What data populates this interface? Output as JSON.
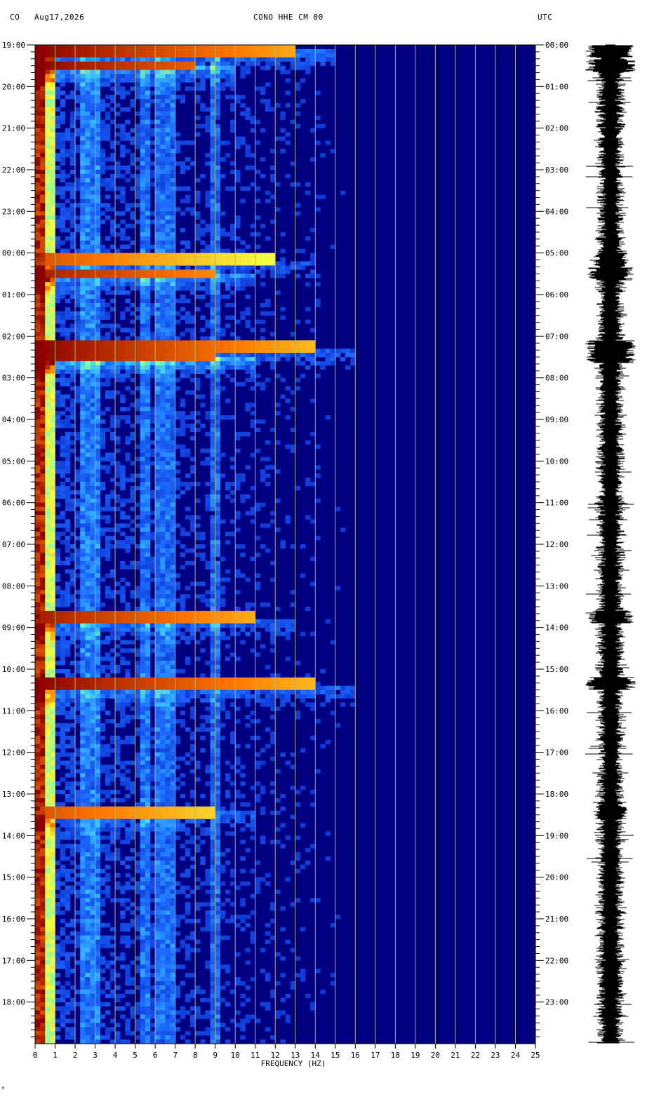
{
  "header": {
    "network": "CO",
    "date": "Aug17,2026",
    "channel": "CONO HHE CM 00",
    "utc_label": "UTC"
  },
  "footer_mark": "*",
  "colors": {
    "background": "#000080",
    "low": "#0a1fb4",
    "mid": "#3fb7ff",
    "high_yellow": "#f5ff40",
    "saturated": "#8b0000",
    "grid": "#b6b26a",
    "trace": "#000000"
  },
  "chart_data": {
    "type": "heatmap",
    "title": "CONO HHE CM 00",
    "xlabel": "FREQUENCY (HZ)",
    "xlim": [
      0,
      25
    ],
    "x_ticks": [
      "0",
      "1",
      "2",
      "3",
      "4",
      "5",
      "6",
      "7",
      "8",
      "9",
      "10",
      "11",
      "12",
      "13",
      "14",
      "15",
      "16",
      "17",
      "18",
      "19",
      "20",
      "21",
      "22",
      "23",
      "24",
      "25"
    ],
    "left_time_labels": [
      "19:00",
      "20:00",
      "21:00",
      "22:00",
      "23:00",
      "00:00",
      "01:00",
      "02:00",
      "03:00",
      "04:00",
      "05:00",
      "06:00",
      "07:00",
      "08:00",
      "09:00",
      "10:00",
      "11:00",
      "12:00",
      "13:00",
      "14:00",
      "15:00",
      "16:00",
      "17:00",
      "18:00"
    ],
    "right_time_labels": [
      "00:00",
      "01:00",
      "02:00",
      "03:00",
      "04:00",
      "05:00",
      "06:00",
      "07:00",
      "08:00",
      "09:00",
      "10:00",
      "11:00",
      "12:00",
      "13:00",
      "14:00",
      "15:00",
      "16:00",
      "17:00",
      "18:00",
      "19:00",
      "20:00",
      "21:00",
      "22:00",
      "23:00"
    ],
    "time_span_hours": 24,
    "grid_lines": "vertical, every 1 Hz",
    "energy_bursts": [
      {
        "hour_offset": 0.15,
        "fmax_hz": 13,
        "strength": 1.0
      },
      {
        "hour_offset": 0.5,
        "fmax_hz": 8,
        "strength": 1.0
      },
      {
        "hour_offset": 5.15,
        "fmax_hz": 12,
        "strength": 0.7
      },
      {
        "hour_offset": 5.5,
        "fmax_hz": 9,
        "strength": 0.9
      },
      {
        "hour_offset": 7.25,
        "fmax_hz": 14,
        "strength": 1.0
      },
      {
        "hour_offset": 7.5,
        "fmax_hz": 9,
        "strength": 1.0
      },
      {
        "hour_offset": 13.75,
        "fmax_hz": 11,
        "strength": 0.9
      },
      {
        "hour_offset": 15.35,
        "fmax_hz": 14,
        "strength": 1.0
      },
      {
        "hour_offset": 18.45,
        "fmax_hz": 9,
        "strength": 0.7
      }
    ],
    "persistent_bands_hz": [
      2.5,
      3.0,
      5.5,
      6.2,
      6.8,
      9.0
    ]
  }
}
